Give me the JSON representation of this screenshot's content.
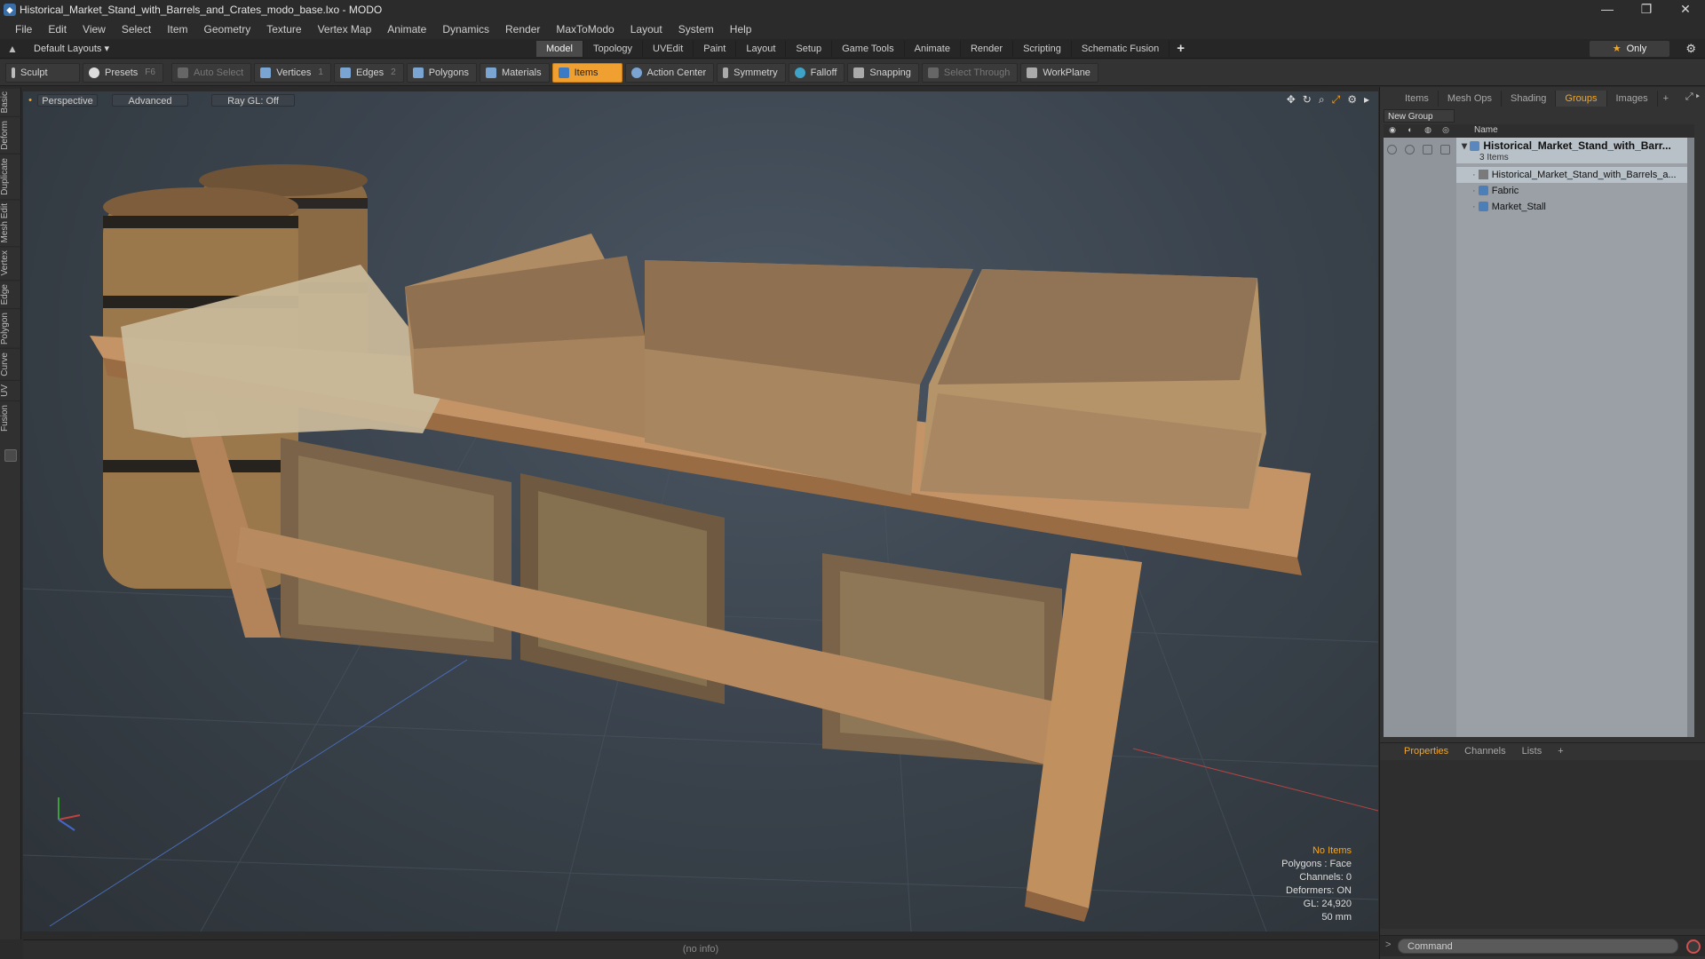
{
  "window": {
    "title": "Historical_Market_Stand_with_Barrels_and_Crates_modo_base.lxo - MODO",
    "controls": [
      "—",
      "❐",
      "✕"
    ]
  },
  "menu": [
    "File",
    "Edit",
    "View",
    "Select",
    "Item",
    "Geometry",
    "Texture",
    "Vertex Map",
    "Animate",
    "Dynamics",
    "Render",
    "MaxToModo",
    "Layout",
    "System",
    "Help"
  ],
  "layout": {
    "selector": "Default Layouts ▾",
    "tabs": [
      "Model",
      "Topology",
      "UVEdit",
      "Paint",
      "Layout",
      "Setup",
      "Game Tools",
      "Animate",
      "Render",
      "Scripting",
      "Schematic Fusion"
    ],
    "active_tab": "Model",
    "only_label": "Only"
  },
  "toolbar": {
    "sculpt": "Sculpt",
    "presets": "Presets",
    "presets_key": "F6",
    "auto_select": "Auto Select",
    "vertices": "Vertices",
    "vertices_key": "1",
    "edges": "Edges",
    "edges_key": "2",
    "polygons": "Polygons",
    "materials": "Materials",
    "items": "Items",
    "action_center": "Action Center",
    "symmetry": "Symmetry",
    "falloff": "Falloff",
    "snapping": "Snapping",
    "select_through": "Select Through",
    "workplane": "WorkPlane"
  },
  "left_tabs": [
    "Basic",
    "Deform",
    "Duplicate",
    "Mesh Edit",
    "Vertex",
    "Edge",
    "Polygon",
    "Curve",
    "UV",
    "Fusion"
  ],
  "viewport": {
    "view": "Perspective",
    "shading": "Advanced",
    "raygl": "Ray GL: Off",
    "info": {
      "items": "No Items",
      "polygons": "Polygons : Face",
      "channels": "Channels: 0",
      "deformers": "Deformers: ON",
      "gl": "GL: 24,920",
      "distance": "50 mm"
    }
  },
  "status": "(no info)",
  "right_panel": {
    "tabs": [
      "Items",
      "Mesh Ops",
      "Shading",
      "Groups",
      "Images"
    ],
    "active_tab": "Groups",
    "new_group": "New Group",
    "name_col": "Name",
    "tree": {
      "group_name": "Historical_Market_Stand_with_Barr...",
      "group_count": "3 Items",
      "children": [
        "Historical_Market_Stand_with_Barrels_a...",
        "Fabric",
        "Market_Stall"
      ]
    },
    "bottom_tabs": [
      "Properties",
      "Channels",
      "Lists"
    ],
    "bottom_active": "Properties",
    "command_placeholder": "Command"
  },
  "colors": {
    "accent": "#f4a623",
    "items_active": "#f0a030",
    "viewport_bg": "#3b444e"
  }
}
